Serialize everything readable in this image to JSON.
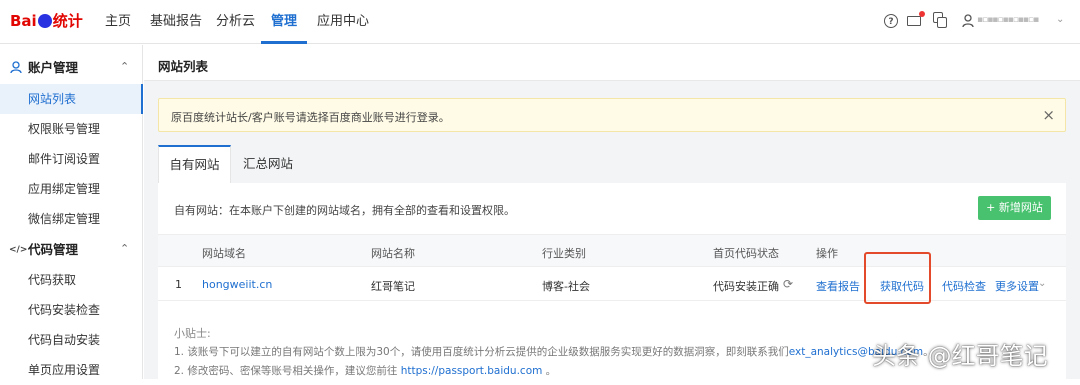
{
  "logo": {
    "text_bai": "Bai",
    "text_tj": "统计"
  },
  "nav": {
    "items": [
      {
        "label": "主页"
      },
      {
        "label": "基础报告"
      },
      {
        "label": "分析云"
      },
      {
        "label": "管理"
      },
      {
        "label": "应用中心"
      }
    ],
    "active": "管理"
  },
  "header_tools": {
    "help": "?",
    "user_caret": "⌄"
  },
  "sidebar": {
    "group1": {
      "label": "账户管理",
      "icon": "user-icon",
      "caret": "⌃"
    },
    "group1_items": [
      {
        "label": "网站列表"
      },
      {
        "label": "权限账号管理"
      },
      {
        "label": "邮件订阅设置"
      },
      {
        "label": "应用绑定管理"
      },
      {
        "label": "微信绑定管理"
      }
    ],
    "group2": {
      "label": "代码管理",
      "icon": "</>",
      "caret": "⌃"
    },
    "group2_items": [
      {
        "label": "代码获取"
      },
      {
        "label": "代码安装检查"
      },
      {
        "label": "代码自动安装"
      },
      {
        "label": "单页应用设置"
      }
    ]
  },
  "page": {
    "title": "网站列表"
  },
  "notice": {
    "text": "原百度统计站长/客户账号请选择百度商业账号进行登录。",
    "close": "×"
  },
  "tabs": [
    {
      "label": "自有网站"
    },
    {
      "label": "汇总网站"
    }
  ],
  "card": {
    "desc": "自有网站：在本账户下创建的网站域名，拥有全部的查看和设置权限。",
    "add_button": "+ 新增网站"
  },
  "table": {
    "headers": [
      "网站域名",
      "网站名称",
      "行业类别",
      "首页代码状态",
      "操作"
    ],
    "rows": [
      {
        "index": "1",
        "domain": "hongweiit.cn",
        "name": "红哥笔记",
        "industry": "博客-社会",
        "status": "代码安装正确",
        "ops": [
          "查看报告",
          "获取代码",
          "代码检查",
          "更多设置"
        ]
      }
    ]
  },
  "tips": {
    "title": "小贴士:",
    "line1_prefix": "1. 该账号下可以建立的自有网站个数上限为30个，请使用百度统计分析云提供的企业级数据服务实现更好的数据洞察，即刻联系我们",
    "line1_link": "ext_analytics@baidu.com",
    "line1_suffix": "。",
    "line2_prefix": "2. 修改密码、密保等账号相关操作，建议您前往 ",
    "line2_link": "https://passport.baidu.com",
    "line2_suffix": " 。"
  },
  "watermark": "头条 @红哥笔记",
  "colors": {
    "accent": "#1f6fd0",
    "add_button": "#49c26f",
    "highlight_box": "#e24a2b",
    "notice_bg": "#fffbe6"
  }
}
